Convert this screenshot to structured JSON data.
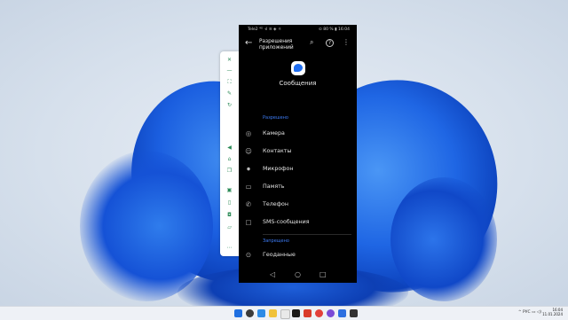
{
  "statusbar": {
    "carrier": "Tele2 ⁴ᴳ ·ıl ≋ ◈ ☼",
    "battery_time": "⊙ 80 % ▮ 16:04"
  },
  "appbar": {
    "title_line1": "Разрешения",
    "title_line2": "приложений",
    "back_icon": "←",
    "search_icon": "⌕",
    "help_icon": "?",
    "menu_icon": "⋮"
  },
  "app": {
    "name": "Сообщения",
    "icon_color": "#1e6df0"
  },
  "sections": {
    "allowed": "Разрешено",
    "denied": "Запрещено"
  },
  "permissions_allowed": [
    {
      "icon": "camera-icon",
      "glyph": "◎",
      "label": "Камера"
    },
    {
      "icon": "contacts-icon",
      "glyph": "☺",
      "label": "Контакты"
    },
    {
      "icon": "microphone-icon",
      "glyph": "⏺",
      "label": "Микрофон"
    },
    {
      "icon": "folder-icon",
      "glyph": "▭",
      "label": "Память"
    },
    {
      "icon": "phone-icon",
      "glyph": "✆",
      "label": "Телефон"
    },
    {
      "icon": "sms-icon",
      "glyph": "▢",
      "label": "SMS-сообщения"
    }
  ],
  "permissions_denied": [
    {
      "icon": "location-icon",
      "glyph": "⊙",
      "label": "Геоданные"
    }
  ],
  "navbar": {
    "back": "◁",
    "home": "○",
    "recents": "□"
  },
  "toolbar": {
    "items": [
      {
        "name": "close-icon",
        "glyph": "✕"
      },
      {
        "name": "minimize-icon",
        "glyph": "—"
      },
      {
        "name": "fullscreen-icon",
        "glyph": "⛶"
      },
      {
        "name": "pin-icon",
        "glyph": "✎"
      },
      {
        "name": "rotate-icon",
        "glyph": "↻"
      },
      {
        "name": "volume-icon",
        "glyph": "◀"
      },
      {
        "name": "home-icon",
        "glyph": "⌂"
      },
      {
        "name": "copy-icon",
        "glyph": "❐"
      },
      {
        "name": "screenshot-icon",
        "glyph": "▣"
      },
      {
        "name": "phone-icon",
        "glyph": "▯"
      },
      {
        "name": "camera-icon",
        "glyph": "◘"
      },
      {
        "name": "folder-icon",
        "glyph": "▱"
      },
      {
        "name": "more-icon",
        "glyph": "⋯"
      }
    ]
  },
  "taskbar": {
    "tray": "^ РУС ▭ ◁)",
    "time": "16:04",
    "date": "11.01.2024"
  }
}
